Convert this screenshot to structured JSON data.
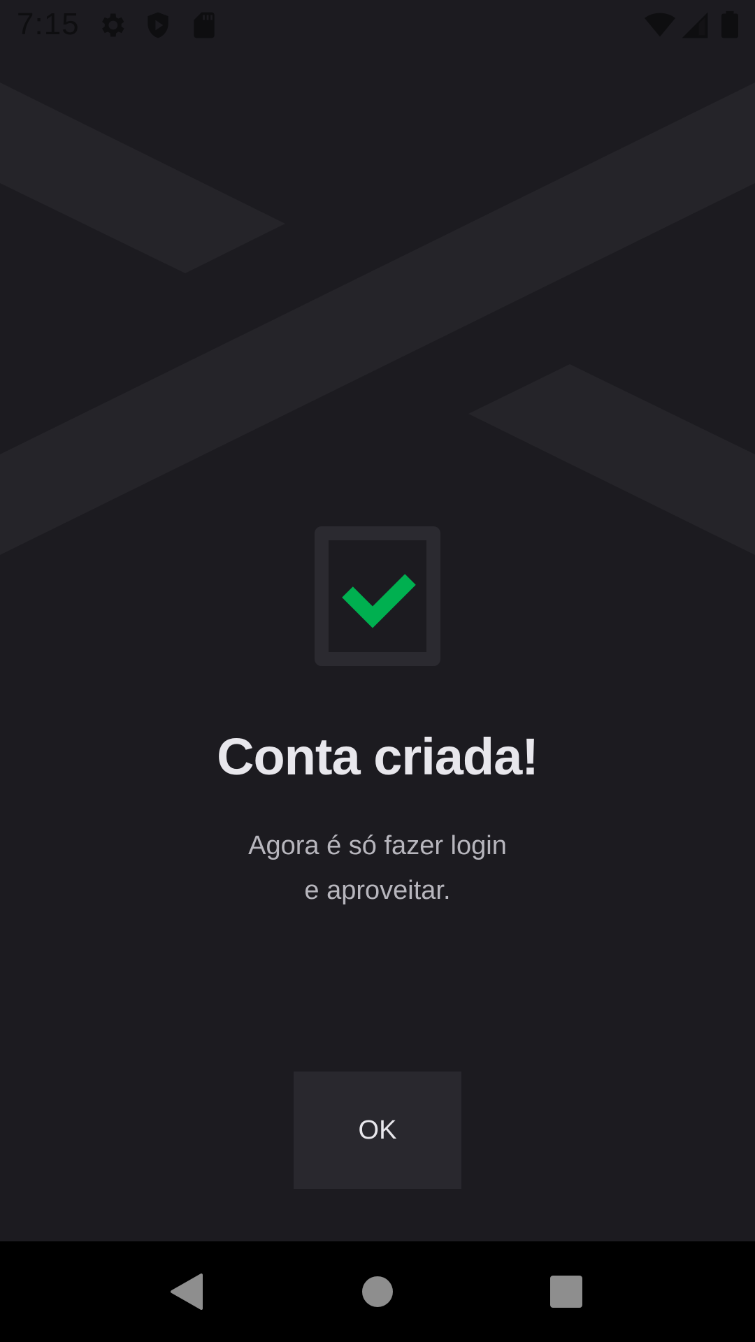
{
  "status_bar": {
    "time": "7:15",
    "left_icons": [
      "gear-icon",
      "shield-play-icon",
      "sd-card-icon"
    ],
    "right_icons": [
      "wifi-icon",
      "cellular-signal-icon",
      "battery-icon"
    ]
  },
  "content": {
    "icon": "checkbox-check-icon",
    "title": "Conta criada!",
    "subtitle_line1": "Agora é só fazer login",
    "subtitle_line2": "e aproveitar.",
    "ok_label": "OK"
  },
  "nav_bar": {
    "buttons": [
      "back-icon",
      "home-icon",
      "recents-icon"
    ]
  },
  "colors": {
    "background": "#1c1b20",
    "pattern": "#252429",
    "accent_green": "#00b050",
    "button_bg": "#29282e",
    "title_text": "#e8e7ec",
    "subtitle_text": "#b7b6bd",
    "nav_background": "#000000",
    "nav_icons": "#8e8e8e"
  }
}
